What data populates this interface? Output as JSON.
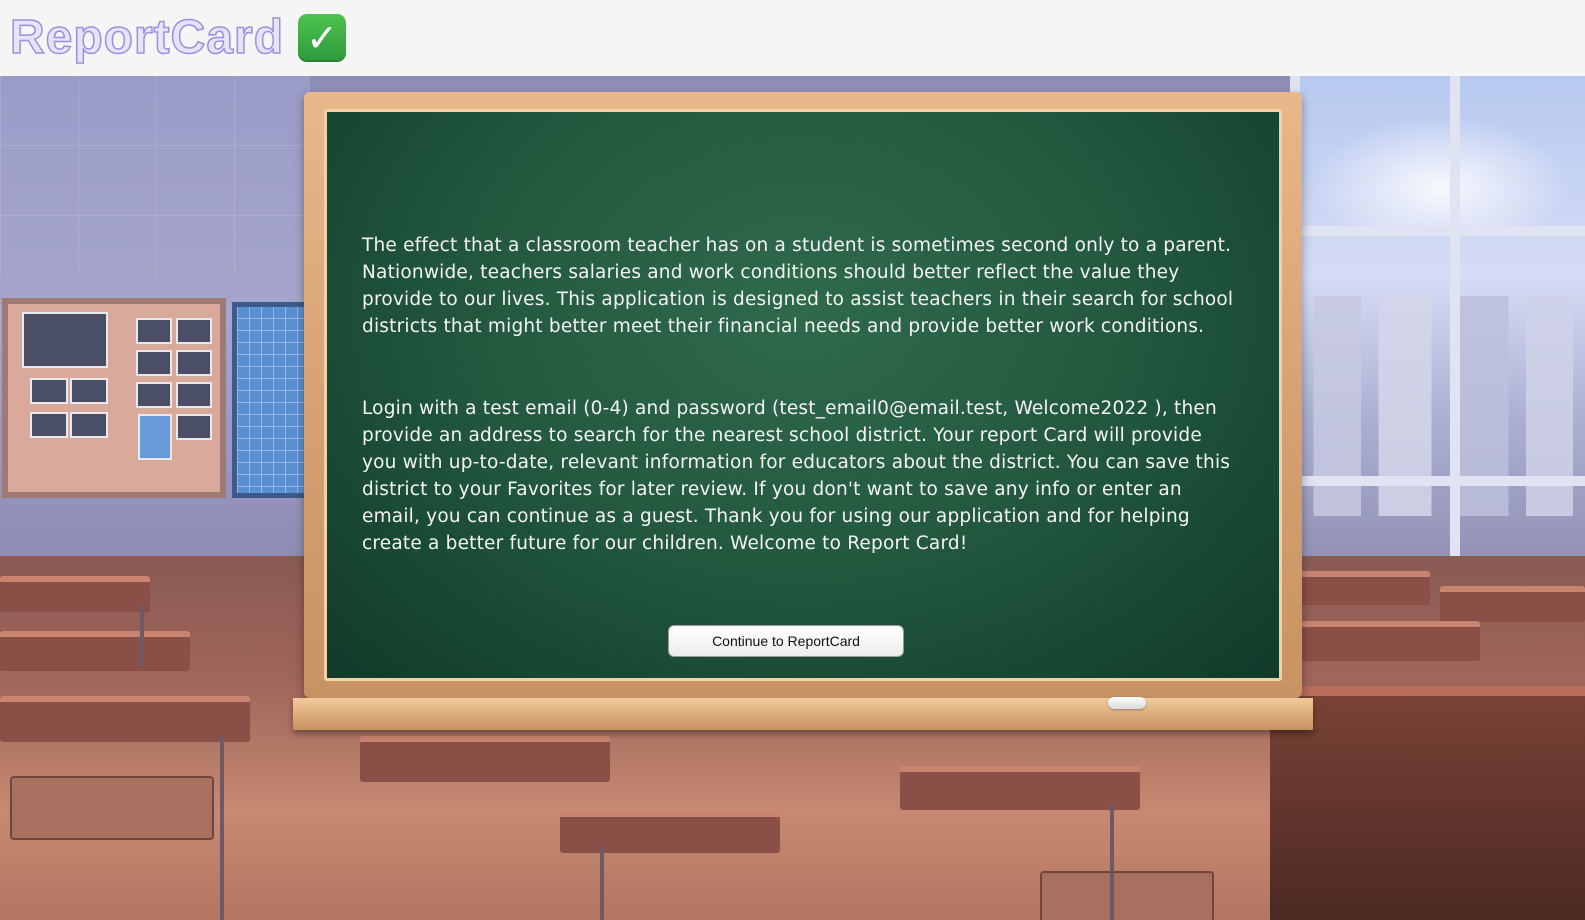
{
  "header": {
    "logo_text": "ReportCard",
    "logo_icon": "check-mark-button-icon",
    "logo_icon_glyph": "✓"
  },
  "board": {
    "intro": "The effect that a classroom teacher has on a student is sometimes second only to a parent. Nationwide, teachers salaries and work conditions should better reflect the value they provide to our lives. This application is designed to assist teachers in their search for school districts that might better meet their financial needs and provide better work conditions.",
    "login_instructions": "Login with a test email (0-4) and password (test_email0@email.test, Welcome2022 ), then provide an address to search for the nearest school district. Your report Card will provide you with up-to-date, relevant information for educators about the district. You can save this district to your Favorites for later review. If you don't want to save any info or enter an email, you can continue as a guest. Thank you for using our application and for helping create a better future for our children. Welcome to Report Card!",
    "continue_label": "Continue to ReportCard"
  },
  "colors": {
    "chalkboard": "#245a40",
    "frame": "#d7a273",
    "header_bg": "#f5f5f5",
    "logo_fill": "#e9e3fa",
    "logo_outline": "#9b8fe0",
    "check_green": "#3fae45"
  }
}
